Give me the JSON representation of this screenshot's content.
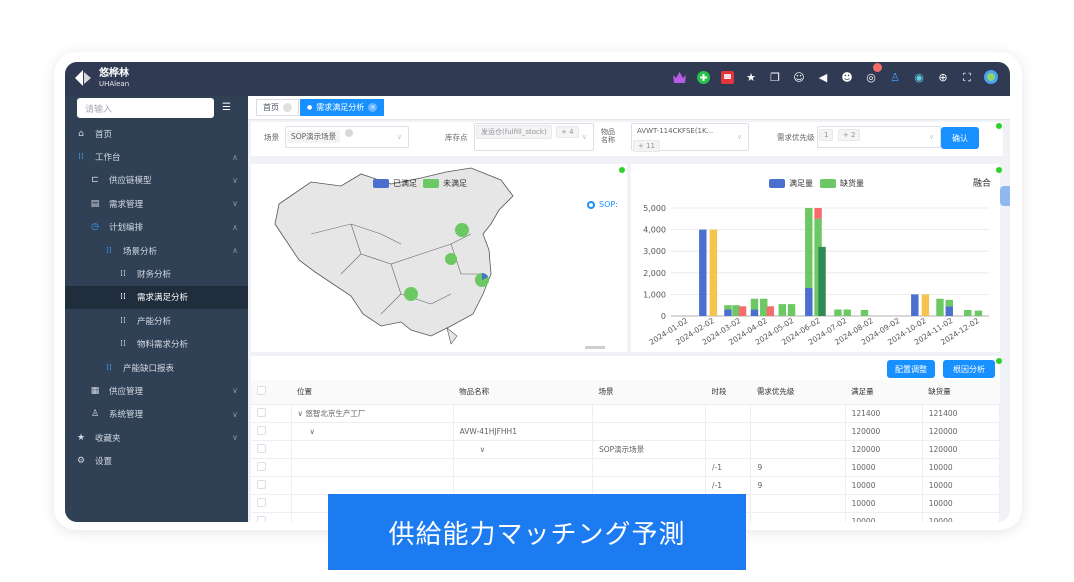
{
  "brand": {
    "name_cn": "悠桦林",
    "name_en": "UHAlean"
  },
  "colors": {
    "topbar": "#303a52",
    "sidebar": "#304156",
    "accent": "#1890ff",
    "fulfilled": "#4a6fcf",
    "unfulfilled": "#6bc862",
    "shortage_green": "#6bc862",
    "banner": "#1d7bf2"
  },
  "search": {
    "placeholder": "请输入"
  },
  "menu": [
    {
      "label": "首页",
      "icon": "home-icon",
      "level": 0
    },
    {
      "label": "工作台",
      "icon": "grid-icon",
      "level": 0,
      "arrow": "up"
    },
    {
      "label": "供应链模型",
      "icon": "model-icon",
      "level": 1,
      "arrow": "down"
    },
    {
      "label": "需求管理",
      "icon": "doc-icon",
      "level": 1,
      "arrow": "down"
    },
    {
      "label": "计划编排",
      "icon": "check-circle-icon",
      "level": 1,
      "arrow": "up"
    },
    {
      "label": "场景分析",
      "icon": "grid-icon",
      "level": 2,
      "arrow": "up"
    },
    {
      "label": "财务分析",
      "icon": "grid-icon",
      "level": 3
    },
    {
      "label": "需求满足分析",
      "icon": "grid-icon",
      "level": 3,
      "active": true
    },
    {
      "label": "产能分析",
      "icon": "grid-icon",
      "level": 3
    },
    {
      "label": "物料需求分析",
      "icon": "grid-icon",
      "level": 3
    },
    {
      "label": "产能缺口报表",
      "icon": "grid-icon",
      "level": 2
    },
    {
      "label": "供应管理",
      "icon": "building-icon",
      "level": 1,
      "arrow": "down"
    },
    {
      "label": "系统管理",
      "icon": "users-icon",
      "level": 1,
      "arrow": "down"
    },
    {
      "label": "收藏夹",
      "icon": "star-icon",
      "level": 0,
      "arrow": "down"
    },
    {
      "label": "设置",
      "icon": "gear-icon",
      "level": 0
    }
  ],
  "tabs": [
    {
      "label": "首页"
    },
    {
      "label": "需求满足分析"
    }
  ],
  "filters": {
    "scene_label": "场景",
    "scene_value": "SOP演示场景",
    "stock_label": "库存点",
    "stock_value": "发运仓(fulfill_stock)",
    "stock_more": "+ 4",
    "item_label": "物品名称",
    "item_value": "AVWT-114CKFSE(1K...",
    "item_more": "+ 11",
    "priority_label": "需求优先级",
    "priority_tags": [
      "1",
      "+ 2"
    ],
    "confirm": "确认"
  },
  "map_panel": {
    "legend": [
      "已满足",
      "未满足"
    ],
    "side_label": "SOP:"
  },
  "bar_panel": {
    "legend": [
      "满足量",
      "缺货量"
    ],
    "mode_label": "融合"
  },
  "chart_data": {
    "type": "bar",
    "categories": [
      "2024-01-02",
      "2024-02-02",
      "2024-03-02",
      "2024-04-02",
      "2024-05-02",
      "2024-06-02",
      "2024-07-02",
      "2024-08-02",
      "2024-09-02",
      "2024-10-02",
      "2024-11-02",
      "2024-12-02"
    ],
    "yticks": [
      0,
      1000,
      2000,
      3000,
      4000,
      5000
    ],
    "ylim": [
      0,
      5000
    ],
    "bars": [
      {
        "x": 1,
        "offset": -0.3,
        "base": 0,
        "value": 4000,
        "color": "#4a6fcf"
      },
      {
        "x": 1,
        "offset": 0.1,
        "base": 0,
        "value": 4000,
        "color": "#f7c34f"
      },
      {
        "x": 2,
        "offset": -0.35,
        "base": 0,
        "value": 300,
        "color": "#4a6fcf"
      },
      {
        "x": 2,
        "offset": -0.35,
        "base": 300,
        "value": 200,
        "color": "#6bc862"
      },
      {
        "x": 2,
        "offset": -0.05,
        "base": 0,
        "value": 500,
        "color": "#6bc862"
      },
      {
        "x": 2,
        "offset": 0.2,
        "base": 0,
        "value": 450,
        "color": "#f56c6c"
      },
      {
        "x": 3,
        "offset": -0.35,
        "base": 0,
        "value": 300,
        "color": "#4a6fcf"
      },
      {
        "x": 3,
        "offset": -0.35,
        "base": 300,
        "value": 500,
        "color": "#6bc862"
      },
      {
        "x": 3,
        "offset": 0.0,
        "base": 0,
        "value": 800,
        "color": "#6bc862"
      },
      {
        "x": 3,
        "offset": 0.25,
        "base": 0,
        "value": 450,
        "color": "#f56c6c"
      },
      {
        "x": 4,
        "offset": -0.3,
        "base": 0,
        "value": 550,
        "color": "#6bc862"
      },
      {
        "x": 4,
        "offset": 0.05,
        "base": 0,
        "value": 550,
        "color": "#6bc862"
      },
      {
        "x": 5,
        "offset": -0.3,
        "base": 0,
        "value": 1300,
        "color": "#4a6fcf"
      },
      {
        "x": 5,
        "offset": -0.3,
        "base": 1300,
        "value": 3700,
        "color": "#6bc862"
      },
      {
        "x": 5,
        "offset": 0.05,
        "base": 0,
        "value": 4500,
        "color": "#6bc862"
      },
      {
        "x": 5,
        "offset": 0.05,
        "base": 4500,
        "value": 500,
        "color": "#f56c6c"
      },
      {
        "x": 5,
        "offset": 0.2,
        "base": 0,
        "value": 3200,
        "color": "#2e8b57"
      },
      {
        "x": 6,
        "offset": -0.2,
        "base": 0,
        "value": 300,
        "color": "#6bc862"
      },
      {
        "x": 6,
        "offset": 0.15,
        "base": 0,
        "value": 300,
        "color": "#6bc862"
      },
      {
        "x": 7,
        "offset": -0.2,
        "base": 0,
        "value": 280,
        "color": "#6bc862"
      },
      {
        "x": 9,
        "offset": -0.3,
        "base": 0,
        "value": 1000,
        "color": "#4a6fcf"
      },
      {
        "x": 9,
        "offset": 0.1,
        "base": 0,
        "value": 1000,
        "color": "#f7c34f"
      },
      {
        "x": 10,
        "offset": -0.35,
        "base": 0,
        "value": 800,
        "color": "#6bc862"
      },
      {
        "x": 10,
        "offset": 0.0,
        "base": 0,
        "value": 450,
        "color": "#4a6fcf"
      },
      {
        "x": 10,
        "offset": 0.0,
        "base": 450,
        "value": 300,
        "color": "#6bc862"
      },
      {
        "x": 11,
        "offset": -0.3,
        "base": 0,
        "value": 280,
        "color": "#6bc862"
      },
      {
        "x": 11,
        "offset": 0.1,
        "base": 0,
        "value": 250,
        "color": "#6bc862"
      }
    ],
    "legend": [
      "满足量",
      "缺货量"
    ]
  },
  "buttons": {
    "adjust": "配置调整",
    "root_cause": "根因分析"
  },
  "table": {
    "headers": [
      "位置",
      "物品名称",
      "场景",
      "时段",
      "需求优先级",
      "满足量",
      "缺货量"
    ],
    "rows": [
      {
        "loc": "悠智北京生产工厂",
        "item": "",
        "scene": "",
        "period": "",
        "prio": "",
        "met": "121400",
        "short": "121400",
        "tree": "∨"
      },
      {
        "loc": "",
        "item": "AVW-41HJFHH1",
        "scene": "",
        "period": "",
        "prio": "",
        "met": "120000",
        "short": "120000",
        "tree": "∨"
      },
      {
        "loc": "",
        "item": "",
        "scene": "SOP演示场景",
        "period": "",
        "prio": "",
        "met": "120000",
        "short": "120000",
        "tree": "∨"
      },
      {
        "loc": "",
        "item": "",
        "scene": "",
        "period": "/-1",
        "prio": "9",
        "met": "10000",
        "short": "10000",
        "tree": ""
      },
      {
        "loc": "",
        "item": "",
        "scene": "",
        "period": "/-1",
        "prio": "9",
        "met": "10000",
        "short": "10000",
        "tree": ""
      },
      {
        "loc": "",
        "item": "",
        "scene": "",
        "period": "",
        "prio": "",
        "met": "10000",
        "short": "10000",
        "tree": ""
      },
      {
        "loc": "",
        "item": "",
        "scene": "",
        "period": "",
        "prio": "",
        "met": "10000",
        "short": "10000",
        "tree": ""
      }
    ]
  },
  "banner": {
    "text": "供給能力マッチング予測"
  }
}
